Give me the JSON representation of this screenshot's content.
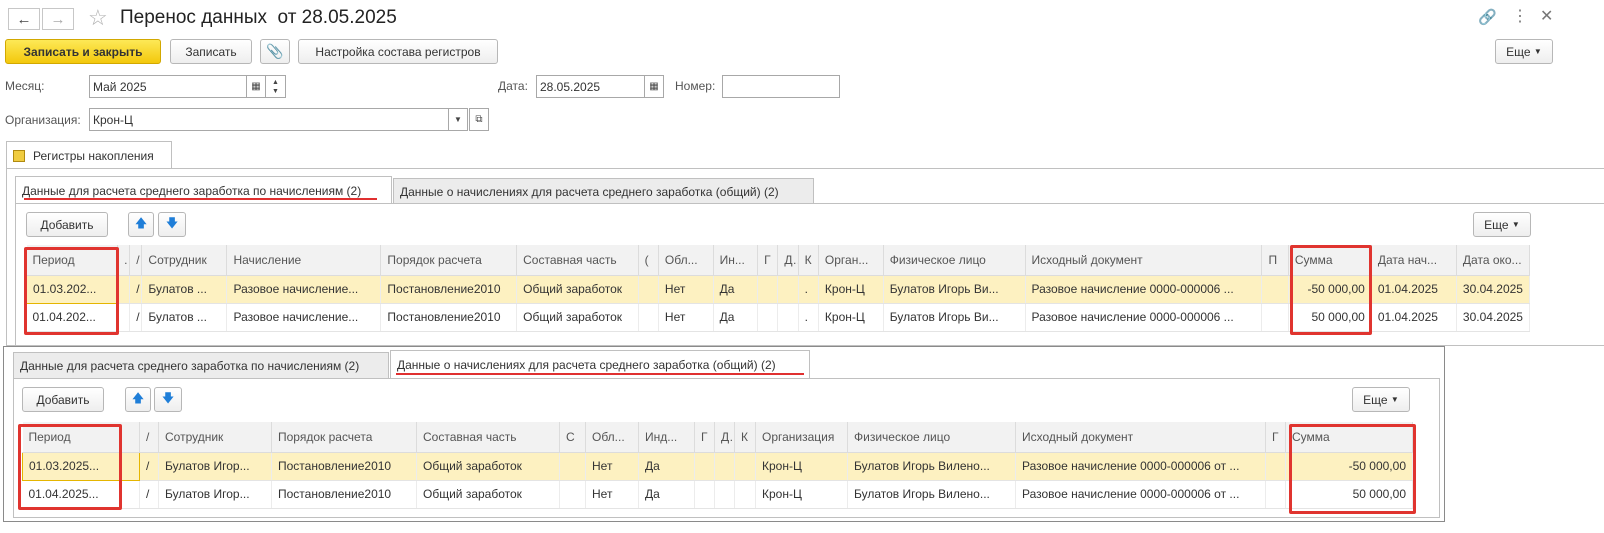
{
  "window": {
    "title": "Перенос данных  от 28.05.2025"
  },
  "toolbar": {
    "save_close": "Записать и закрыть",
    "save": "Записать",
    "registers_setup": "Настройка состава регистров",
    "more": "Еще"
  },
  "form": {
    "month_label": "Месяц:",
    "month_value": "Май 2025",
    "date_label": "Дата:",
    "date_value": "28.05.2025",
    "number_label": "Номер:",
    "number_value": "",
    "org_label": "Организация:",
    "org_value": "Крон-Ц"
  },
  "outer_tab": {
    "label": "Регистры накопления"
  },
  "tabs": [
    "Данные для расчета среднего заработка по начислениям (2)",
    "Данные о начислениях для расчета среднего заработка (общий) (2)"
  ],
  "grid_toolbar": {
    "add": "Добавить",
    "more": "Еще"
  },
  "table1": {
    "columns": [
      "Период",
      ".",
      "/",
      "Сотрудник",
      "Начисление",
      "Порядок расчета",
      "Составная часть",
      "(",
      "Обл...",
      "Ин...",
      "Г",
      "Д",
      "К",
      "Орган...",
      "Физическое лицо",
      "Исходный документ",
      "П",
      "Сумма",
      "Дата нач...",
      "Дата око..."
    ],
    "rows": [
      [
        "01.03.202...",
        "",
        "/",
        "Булатов ...",
        "Разовое начисление...",
        "Постановление2010",
        "Общий заработок",
        "",
        "Нет",
        "Да",
        "",
        "",
        ".",
        "Крон-Ц",
        "Булатов Игорь Ви...",
        "Разовое начисление 0000-000006 ...",
        "",
        "-50 000,00",
        "01.04.2025",
        "30.04.2025"
      ],
      [
        "01.04.202...",
        "",
        "/",
        "Булатов ...",
        "Разовое начисление...",
        "Постановление2010",
        "Общий заработок",
        "",
        "Нет",
        "Да",
        "",
        "",
        ".",
        "Крон-Ц",
        "Булатов Игорь Ви...",
        "Разовое начисление 0000-000006 ...",
        "",
        "50 000,00",
        "01.04.2025",
        "30.04.2025"
      ]
    ]
  },
  "table2": {
    "columns": [
      "Период",
      "/",
      "Сотрудник",
      "Порядок расчета",
      "Составная часть",
      "С",
      "Обл...",
      "Инд...",
      "Г",
      "Д",
      "К",
      "Организация",
      "Физическое лицо",
      "Исходный документ",
      "Г",
      "Сумма"
    ],
    "rows": [
      [
        "01.03.2025...",
        "/",
        "Булатов Игор...",
        "Постановление2010",
        "Общий заработок",
        "",
        "Нет",
        "Да",
        "",
        "",
        "",
        "Крон-Ц",
        "Булатов Игорь Виленo...",
        "Разовое начисление 0000-000006 от ...",
        "",
        "-50 000,00"
      ],
      [
        "01.04.2025...",
        "/",
        "Булатов Игор...",
        "Постановление2010",
        "Общий заработок",
        "",
        "Нет",
        "Да",
        "",
        "",
        "",
        "Крон-Ц",
        "Булатов Игорь Виленo...",
        "Разовое начисление 0000-000006 от ...",
        "",
        "50 000,00"
      ]
    ]
  },
  "colors": {
    "highlight": "#e0342f",
    "primary": "#f3c80c",
    "selected_row": "#fdf1c1"
  }
}
